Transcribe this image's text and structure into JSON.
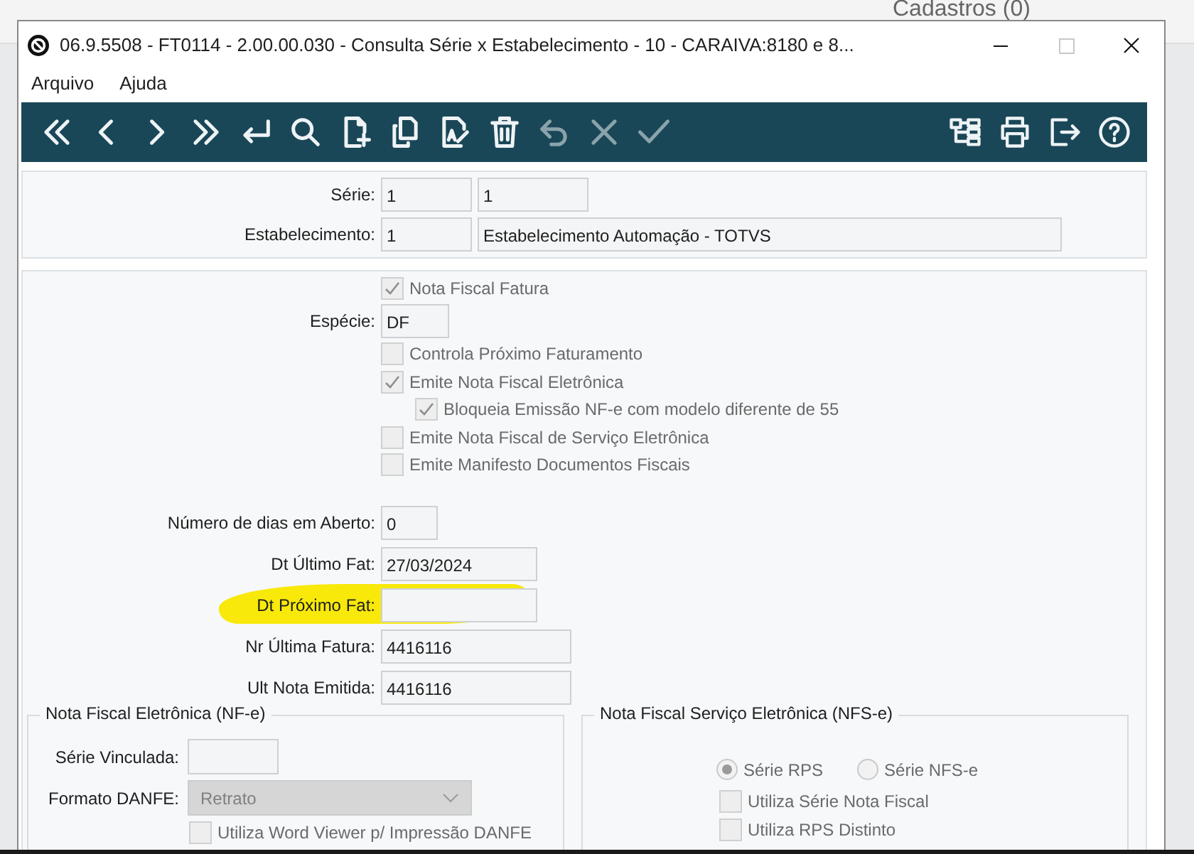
{
  "background": {
    "title": "Cadastros (0)"
  },
  "window": {
    "title": "06.9.5508 - FT0114 - 2.00.00.030 - Consulta Série x Estabelecimento - 10 - CARAIVA:8180 e 8..."
  },
  "menu": [
    "Arquivo",
    "Ajuda"
  ],
  "toolbar": {
    "left": [
      {
        "kind": "first",
        "disabled": false
      },
      {
        "kind": "prev",
        "disabled": false
      },
      {
        "kind": "next",
        "disabled": false
      },
      {
        "kind": "last",
        "disabled": false
      },
      {
        "kind": "enter",
        "disabled": false
      },
      {
        "kind": "search",
        "disabled": false
      },
      {
        "kind": "new",
        "disabled": false
      },
      {
        "kind": "copy",
        "disabled": false
      },
      {
        "kind": "edit",
        "disabled": false
      },
      {
        "kind": "delete",
        "disabled": false
      },
      {
        "kind": "undo",
        "disabled": true
      },
      {
        "kind": "cancel",
        "disabled": true
      },
      {
        "kind": "save",
        "disabled": true
      }
    ],
    "right": [
      {
        "kind": "tree",
        "disabled": false
      },
      {
        "kind": "print",
        "disabled": false
      },
      {
        "kind": "exit",
        "disabled": false
      },
      {
        "kind": "help",
        "disabled": false
      }
    ]
  },
  "header": [
    {
      "label": "Série:",
      "values": [
        "1",
        "1"
      ]
    },
    {
      "label": "Estabelecimento:",
      "values": [
        "1",
        "Estabelecimento Automação - TOTVS"
      ]
    }
  ],
  "options": [
    {
      "kind": "checkbox",
      "label": "Nota Fiscal Fatura",
      "checked": true,
      "disabled": true
    },
    {
      "kind": "field",
      "label": "Espécie:",
      "value": "DF"
    },
    {
      "kind": "checkbox",
      "label": "Controla Próximo Faturamento",
      "checked": false,
      "disabled": true
    },
    {
      "kind": "checkbox",
      "label": "Emite Nota Fiscal Eletrônica",
      "checked": true,
      "disabled": true,
      "children": [
        {
          "kind": "checkbox",
          "label": "Bloqueia Emissão NF-e com modelo diferente de 55",
          "checked": true,
          "disabled": true
        }
      ]
    },
    {
      "kind": "checkbox",
      "label": "Emite Nota Fiscal de Serviço Eletrônica",
      "checked": false,
      "disabled": true
    },
    {
      "kind": "checkbox",
      "label": "Emite Manifesto Documentos Fiscais",
      "checked": false,
      "disabled": true
    }
  ],
  "fields": [
    {
      "label": "Número de dias em Aberto:",
      "value": "0",
      "highlighted": false
    },
    {
      "label": "Dt Último Fat:",
      "value": "27/03/2024",
      "highlighted": false
    },
    {
      "label": "Dt Próximo Fat:",
      "highlighted": true
    },
    {
      "label": "Nr Última Fatura:",
      "value": "4416116",
      "highlighted": false
    },
    {
      "label": "Ult Nota Emitida:",
      "value": "4416116",
      "highlighted": false
    }
  ],
  "nfe": {
    "title": "Nota Fiscal Eletrônica (NF-e)",
    "serie_label": "Série Vinculada:",
    "danfe_label": "Formato DANFE:",
    "danfe_value": "Retrato",
    "danfe_disabled": true,
    "checkbox": {
      "label": "Utiliza Word Viewer p/ Impressão DANFE",
      "checked": false,
      "disabled": true
    }
  },
  "nfse": {
    "title": "Nota Fiscal Serviço Eletrônica (NFS-e)",
    "radios": [
      {
        "label": "Série RPS",
        "selected": true,
        "disabled": true
      },
      {
        "label": "Série NFS-e",
        "selected": false,
        "disabled": true
      }
    ],
    "checkboxes": [
      {
        "label": "Utiliza Série Nota Fiscal",
        "checked": false,
        "disabled": true
      },
      {
        "label": "Utiliza RPS Distinto",
        "checked": false,
        "disabled": true
      }
    ]
  }
}
